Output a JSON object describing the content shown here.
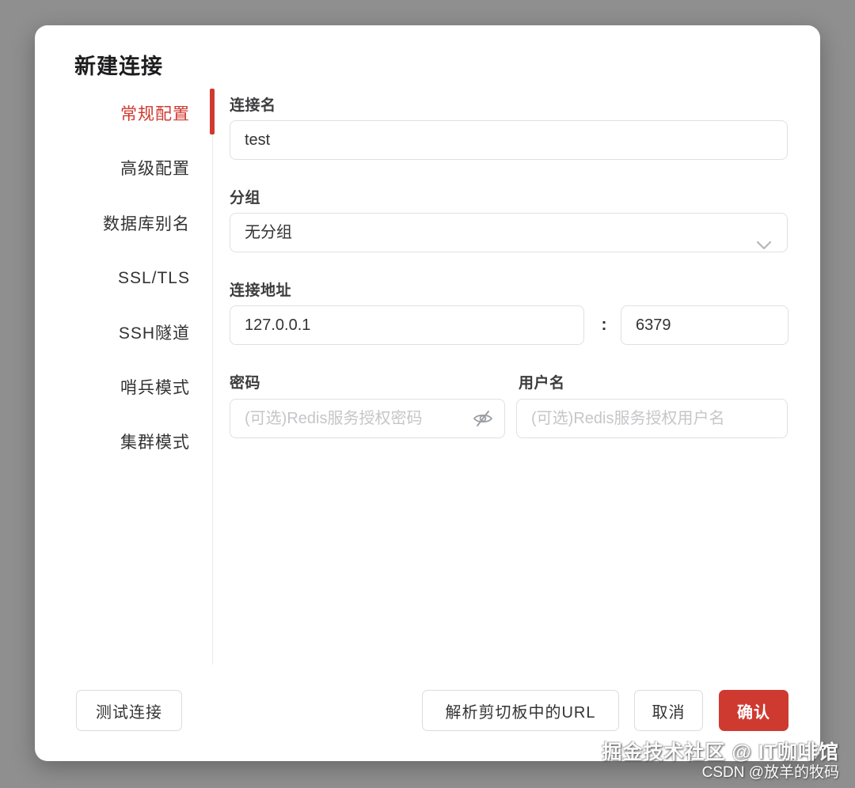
{
  "dialog": {
    "title": "新建连接",
    "tabs": [
      {
        "label": "常规配置",
        "active": true
      },
      {
        "label": "高级配置",
        "active": false
      },
      {
        "label": "数据库别名",
        "active": false
      },
      {
        "label": "SSL/TLS",
        "active": false
      },
      {
        "label": "SSH隧道",
        "active": false
      },
      {
        "label": "哨兵模式",
        "active": false
      },
      {
        "label": "集群模式",
        "active": false
      }
    ],
    "form": {
      "name": {
        "label": "连接名",
        "value": "test"
      },
      "group": {
        "label": "分组",
        "value": "无分组",
        "icon": "chevron-down-icon"
      },
      "address": {
        "label": "连接地址",
        "host": "127.0.0.1",
        "separator": ":",
        "port": "6379"
      },
      "password": {
        "label": "密码",
        "placeholder": "(可选)Redis服务授权密码",
        "value": "",
        "icon": "eye-off-icon"
      },
      "username": {
        "label": "用户名",
        "placeholder": "(可选)Redis服务授权用户名",
        "value": ""
      }
    },
    "footer": {
      "test_label": "测试连接",
      "parse_url_label": "解析剪切板中的URL",
      "cancel_label": "取消",
      "confirm_label": "确认"
    }
  },
  "watermark": {
    "line1": "掘金技术社区 @ IT咖啡馆",
    "line2": "CSDN @放羊的牧码"
  },
  "colors": {
    "accent_red": "#cf3a30",
    "background_gray": "#8f8f8f",
    "border_gray": "#e0e0e3",
    "placeholder_gray": "#c6c6ca"
  }
}
